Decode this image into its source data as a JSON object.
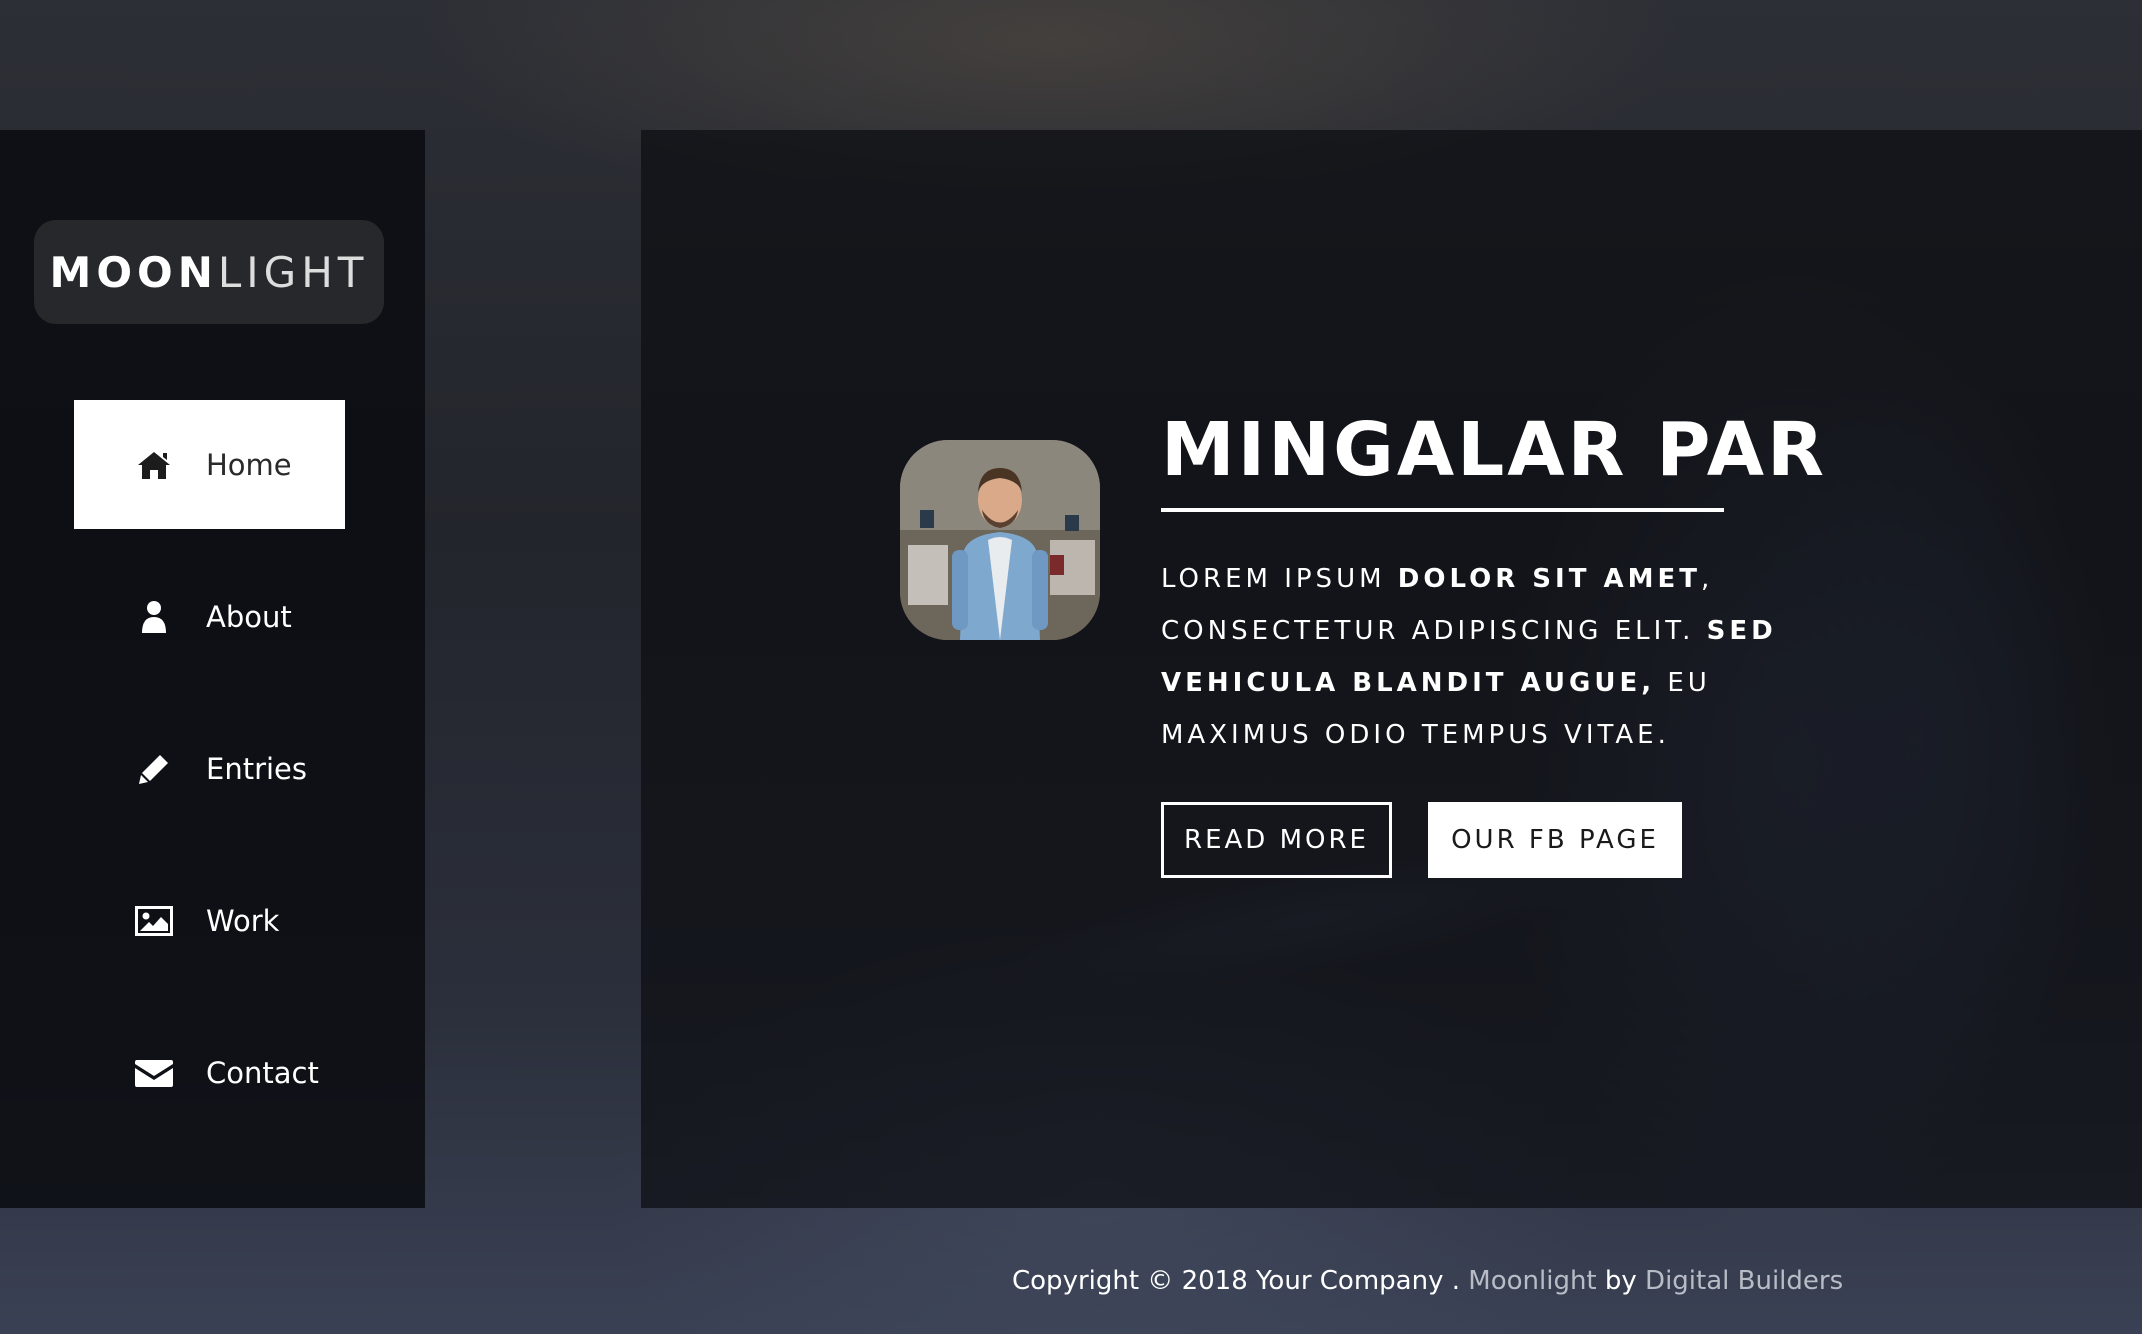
{
  "brand": {
    "strong": "MOON",
    "light": "LIGHT"
  },
  "nav": {
    "items": [
      {
        "label": "Home",
        "icon": "home-icon",
        "active": true
      },
      {
        "label": "About",
        "icon": "user-icon",
        "active": false
      },
      {
        "label": "Entries",
        "icon": "pencil-icon",
        "active": false
      },
      {
        "label": "Work",
        "icon": "image-icon",
        "active": false
      },
      {
        "label": "Contact",
        "icon": "envelope-icon",
        "active": false
      }
    ]
  },
  "hero": {
    "title": "MINGALAR PAR",
    "text_1": "LOREM IPSUM ",
    "text_2": "DOLOR SIT AMET",
    "text_3": ", CONSECTETUR ADIPISCING ELIT. ",
    "text_4": "SED VEHICULA BLANDIT AUGUE,",
    "text_5": " EU MAXIMUS ODIO TEMPUS VITAE.",
    "read_more": "READ MORE",
    "fb_page": "OUR FB PAGE"
  },
  "footer": {
    "copyright": "Copyright © 2018 Your Company . ",
    "brand": "Moonlight",
    "by": " by ",
    "author": "Digital Builders"
  },
  "colors": {
    "sidebar_bg": "#0a0c10",
    "active_item_bg": "#ffffff",
    "accent_text": "#ffffff"
  }
}
